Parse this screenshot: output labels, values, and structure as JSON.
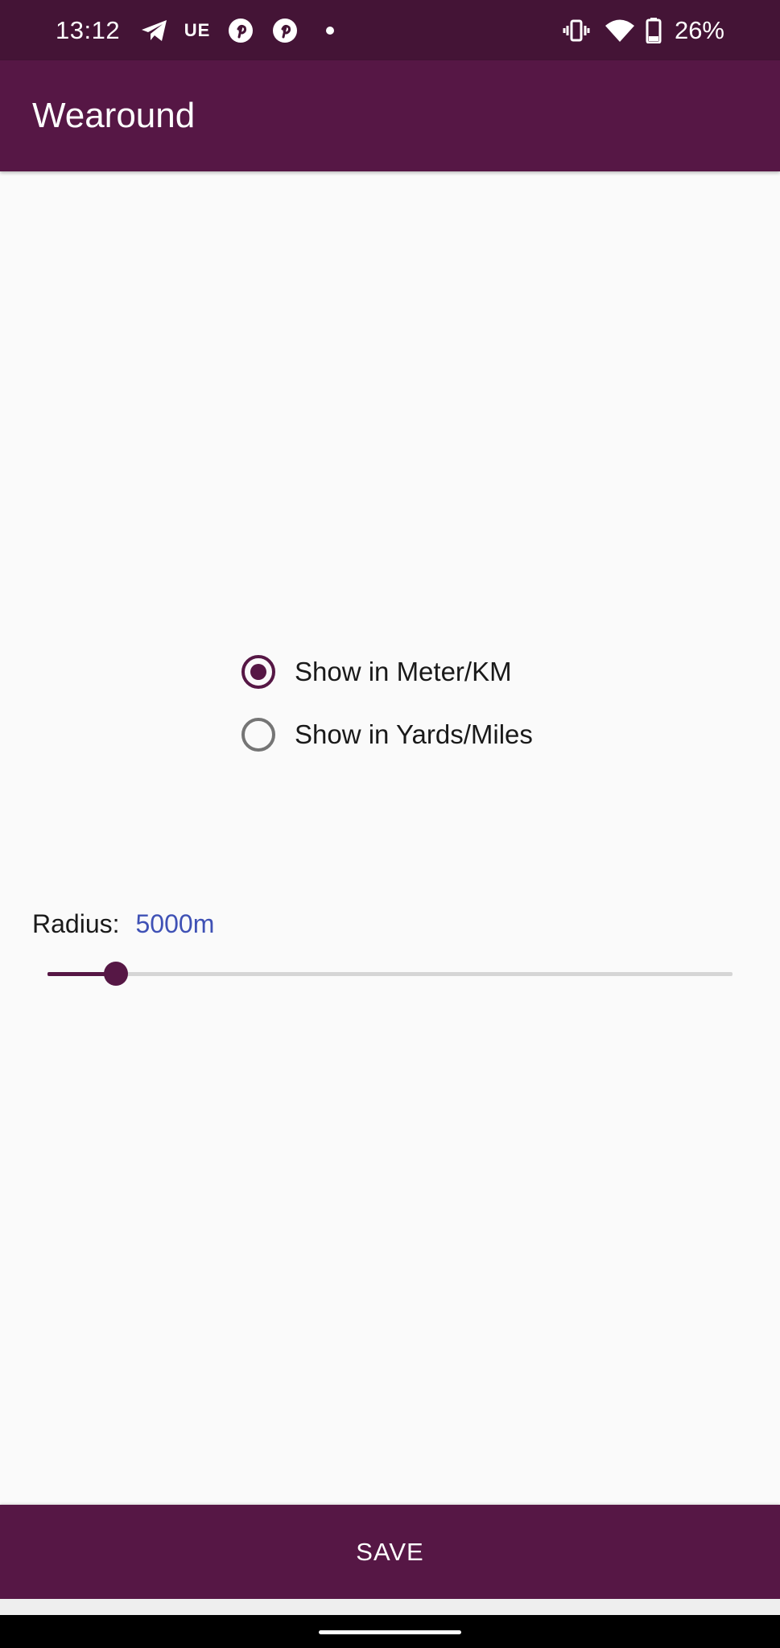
{
  "status_bar": {
    "time": "13:12",
    "notification_icons": [
      "telegram-icon",
      "ue-icon",
      "pinterest-icon",
      "pinterest-icon",
      "more-dot-icon"
    ],
    "ue_label": "UE",
    "system_icons": [
      "vibrate-icon",
      "wifi-icon",
      "battery-icon"
    ],
    "battery_percent": "26%"
  },
  "app_bar": {
    "title": "Wearound"
  },
  "units": {
    "options": [
      {
        "label": "Show in Meter/KM",
        "checked": true
      },
      {
        "label": "Show in Yards/Miles",
        "checked": false
      }
    ]
  },
  "radius": {
    "label": "Radius:",
    "value": "5000m",
    "slider_fraction": 0.1
  },
  "save": {
    "label": "SAVE"
  },
  "colors": {
    "status_bar": "#441436",
    "primary": "#561745",
    "accent_value": "#3f51b5",
    "background": "#fafafa"
  }
}
